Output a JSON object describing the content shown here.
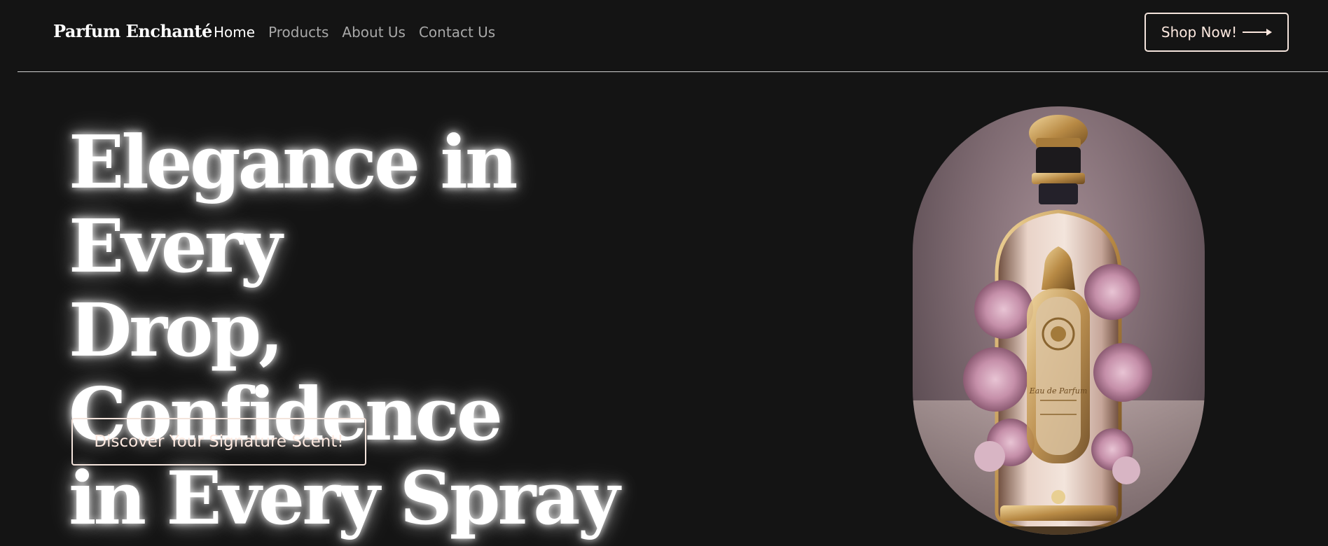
{
  "header": {
    "logo": "Parfum Enchanté",
    "nav": [
      {
        "label": "Home",
        "active": true
      },
      {
        "label": "Products",
        "active": false
      },
      {
        "label": "About Us",
        "active": false
      },
      {
        "label": "Contact Us",
        "active": false
      }
    ],
    "cta_label": "Shop Now!",
    "cta_icon": "arrow-right-icon"
  },
  "hero": {
    "headline_lines": [
      "Elegance in Every",
      "Drop, Confidence",
      "in Every Spray"
    ],
    "button_label": "Discover Your Signature Scent!",
    "image_label": "Eau de Parfum"
  },
  "colors": {
    "background": "#141414",
    "text": "#ffffff",
    "nav_inactive": "#a8a8a8",
    "button_border": "#f4e4dc",
    "bottle_gold": "#c9a25c",
    "flowers": "#c995ad"
  }
}
